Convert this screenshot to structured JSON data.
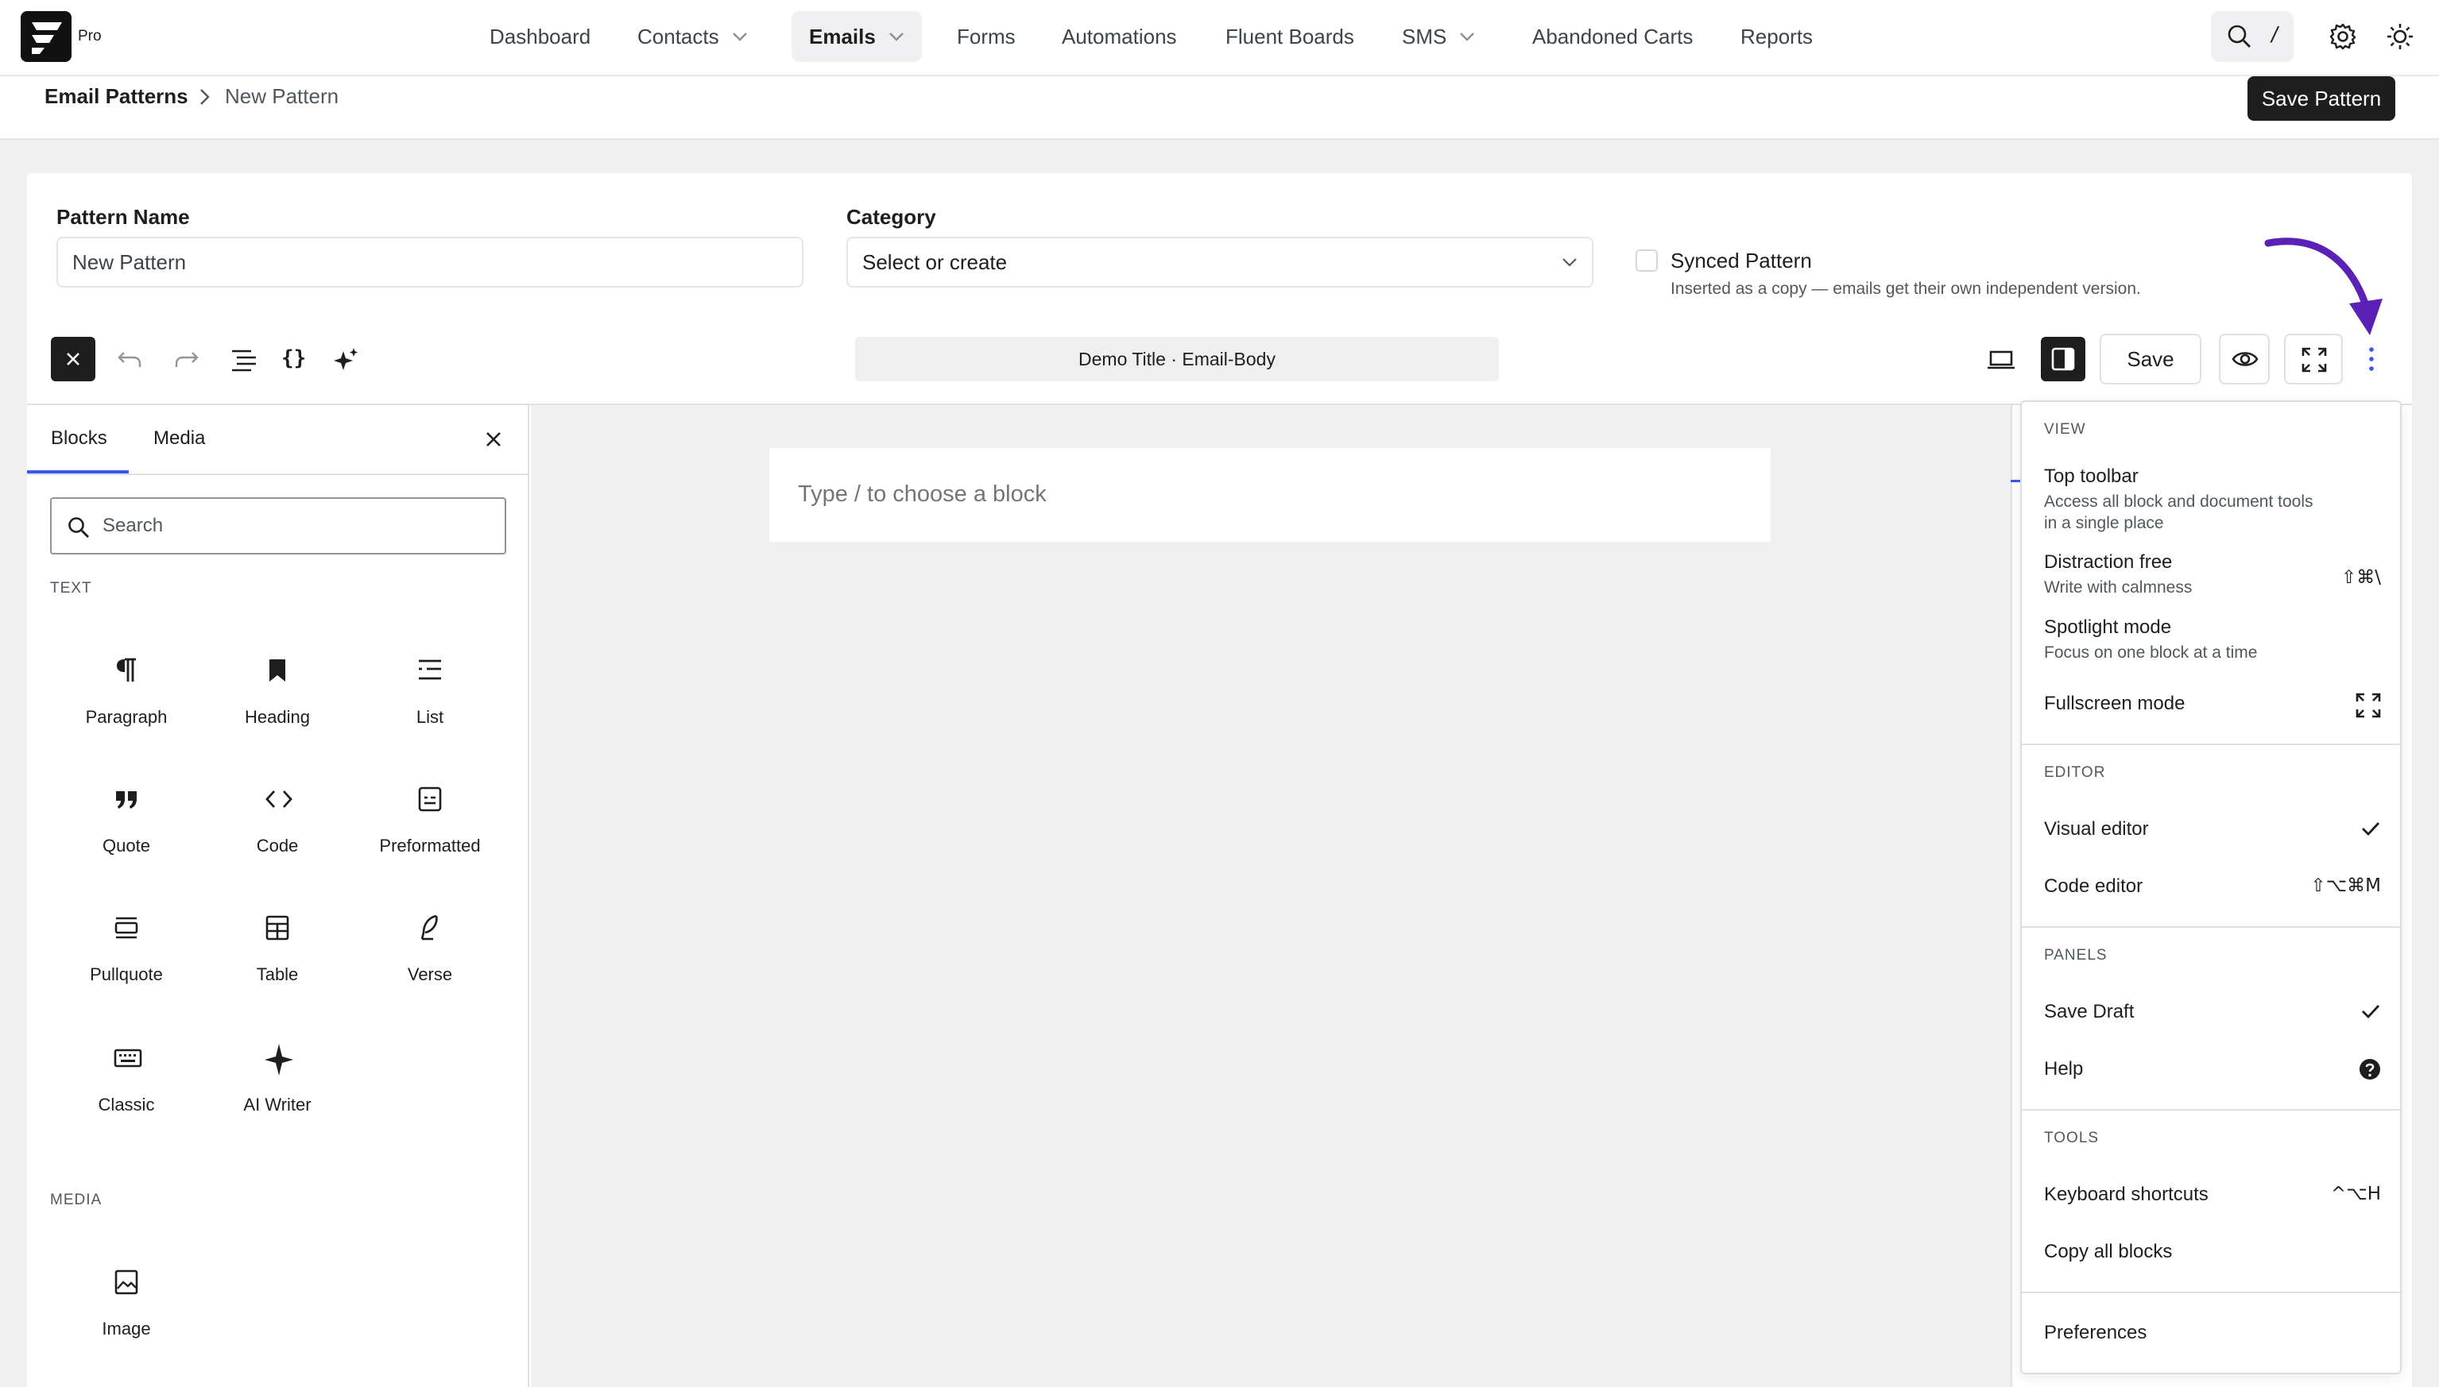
{
  "app": {
    "badge": "Pro"
  },
  "nav": {
    "items": [
      {
        "label": "Dashboard"
      },
      {
        "label": "Contacts"
      },
      {
        "label": "Emails"
      },
      {
        "label": "Forms"
      },
      {
        "label": "Automations"
      },
      {
        "label": "Fluent Boards"
      },
      {
        "label": "SMS"
      },
      {
        "label": "Abandoned Carts"
      },
      {
        "label": "Reports"
      }
    ],
    "active": "Emails",
    "shortcut_hint": "/"
  },
  "breadcrumb": {
    "root": "Email Patterns",
    "current": "New Pattern"
  },
  "header": {
    "save_button": "Save Pattern"
  },
  "form": {
    "pattern_name": {
      "label": "Pattern Name",
      "value": "New Pattern"
    },
    "category": {
      "label": "Category",
      "value": "Select or create"
    },
    "synced": {
      "title": "Synced Pattern",
      "description": "Inserted as a copy — emails get their own independent version.",
      "checked": false
    }
  },
  "editor": {
    "document_title": "Demo Title · Email-Body",
    "save_label": "Save",
    "placeholder": "Type / to choose a block"
  },
  "inserter": {
    "tabs": [
      {
        "label": "Blocks"
      },
      {
        "label": "Media"
      }
    ],
    "active_tab": "Blocks",
    "search_placeholder": "Search",
    "sections": [
      {
        "title": "TEXT",
        "blocks": [
          {
            "label": "Paragraph",
            "icon": "paragraph-icon"
          },
          {
            "label": "Heading",
            "icon": "bookmark-icon"
          },
          {
            "label": "List",
            "icon": "list-icon"
          },
          {
            "label": "Quote",
            "icon": "quote-icon"
          },
          {
            "label": "Code",
            "icon": "code-icon"
          },
          {
            "label": "Preformatted",
            "icon": "preformatted-icon"
          },
          {
            "label": "Pullquote",
            "icon": "pullquote-icon"
          },
          {
            "label": "Table",
            "icon": "table-icon"
          },
          {
            "label": "Verse",
            "icon": "feather-icon"
          },
          {
            "label": "Classic",
            "icon": "keyboard-icon"
          },
          {
            "label": "AI Writer",
            "icon": "sparkle-icon"
          }
        ]
      },
      {
        "title": "MEDIA",
        "blocks": [
          {
            "label": "Image",
            "icon": "image-icon"
          }
        ]
      }
    ]
  },
  "options_menu": {
    "groups": [
      {
        "title": "VIEW",
        "items": [
          {
            "label": "Top toolbar",
            "description": "Access all block and document tools in a single place"
          },
          {
            "label": "Distraction free",
            "description": "Write with calmness",
            "shortcut": "⇧⌘\\"
          },
          {
            "label": "Spotlight mode",
            "description": "Focus on one block at a time"
          },
          {
            "label": "Fullscreen mode",
            "icon": "fullscreen-icon"
          }
        ]
      },
      {
        "title": "EDITOR",
        "items": [
          {
            "label": "Visual editor",
            "icon": "check-icon"
          },
          {
            "label": "Code editor",
            "shortcut": "⇧⌥⌘M"
          }
        ]
      },
      {
        "title": "PANELS",
        "items": [
          {
            "label": "Save Draft",
            "icon": "check-icon"
          },
          {
            "label": "Help",
            "icon": "help-icon"
          }
        ]
      },
      {
        "title": "TOOLS",
        "items": [
          {
            "label": "Keyboard shortcuts",
            "shortcut": "^⌥H"
          },
          {
            "label": "Copy all blocks"
          }
        ]
      },
      {
        "title": "",
        "items": [
          {
            "label": "Preferences"
          }
        ]
      }
    ]
  },
  "colors": {
    "accent": "#3858e9",
    "dark": "#1e1e1e",
    "annotation_arrow": "#5b21b6"
  }
}
